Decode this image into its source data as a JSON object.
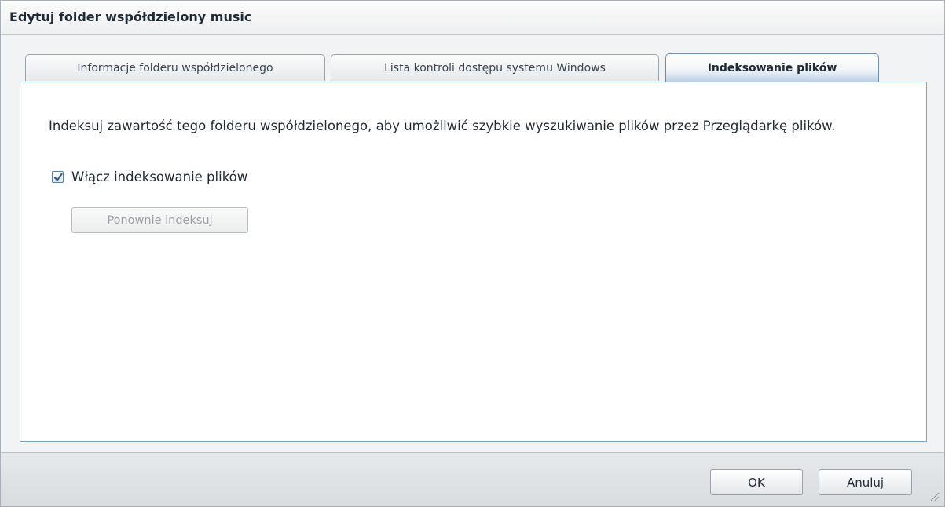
{
  "window": {
    "title": "Edytuj folder współdzielony music"
  },
  "tabs": [
    {
      "label": "Informacje folderu współdzielonego",
      "active": false
    },
    {
      "label": "Lista kontroli dostępu systemu Windows",
      "active": false
    },
    {
      "label": "Indeksowanie plików",
      "active": true
    }
  ],
  "panel": {
    "description": "Indeksuj zawartość tego folderu współdzielonego, aby umożliwić szybkie wyszukiwanie plików przez Przeglądarkę plików.",
    "enable_checkbox": {
      "label": "Włącz indeksowanie plików",
      "checked": true
    },
    "reindex_button": {
      "label": "Ponownie indeksuj",
      "enabled": false
    }
  },
  "footer": {
    "ok_label": "OK",
    "cancel_label": "Anuluj"
  },
  "colors": {
    "accent_border": "#7da3c8",
    "active_tab_bottom": "#b8cde2",
    "check_mark": "#2f5d93"
  }
}
